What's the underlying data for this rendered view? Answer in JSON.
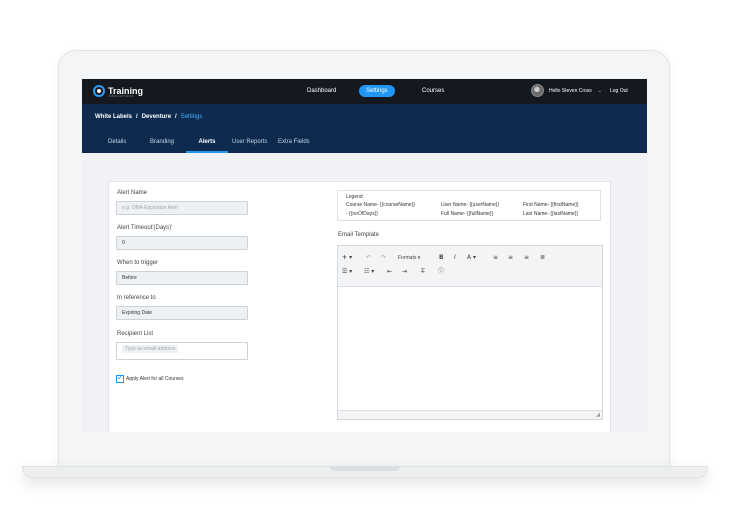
{
  "app": {
    "logo_text": "Training",
    "logo_subtext": "INNOVATIONS"
  },
  "topnav": {
    "items": [
      "Dashboard",
      "Settings",
      "Courses"
    ],
    "active": "Settings",
    "user_greeting": "Hello Steven Cross",
    "logout_label": "Log Out"
  },
  "breadcrumb": [
    "White Labels",
    "Deventure",
    "Settings"
  ],
  "tabs": {
    "items": [
      "Details",
      "Branding",
      "Alerts",
      "User Reports",
      "Extra Fields"
    ],
    "active": "Alerts"
  },
  "form": {
    "alert_name_label": "Alert Name",
    "alert_name_placeholder": "e.g. OMA Expiration Alert",
    "timeout_label": "Alert Timeout'(Days)'",
    "timeout_value": "0",
    "trigger_label": "When to trigger",
    "trigger_value": "Before",
    "reference_label": "In reference to",
    "reference_value": "Expiring Date",
    "recipient_label": "Recipient List",
    "recipient_placeholder": "Type an email address",
    "apply_all_label": "Apply Alert for all Courses",
    "apply_all_checked": true
  },
  "legend": {
    "title": "Legend",
    "items": [
      "Course Name- {{courseName}}",
      "User Name- {{userName}}",
      "First Name- {{firstName}}",
      "- {{noOfDays}}",
      "Full Name- {{fullName}}",
      "Last Name- {{lastName}}"
    ]
  },
  "email_template": {
    "label": "Email Template",
    "formats_label": "Formats"
  },
  "colors": {
    "accent": "#2196f3",
    "topbar": "#14181f",
    "subheader": "#0d2a4f"
  }
}
